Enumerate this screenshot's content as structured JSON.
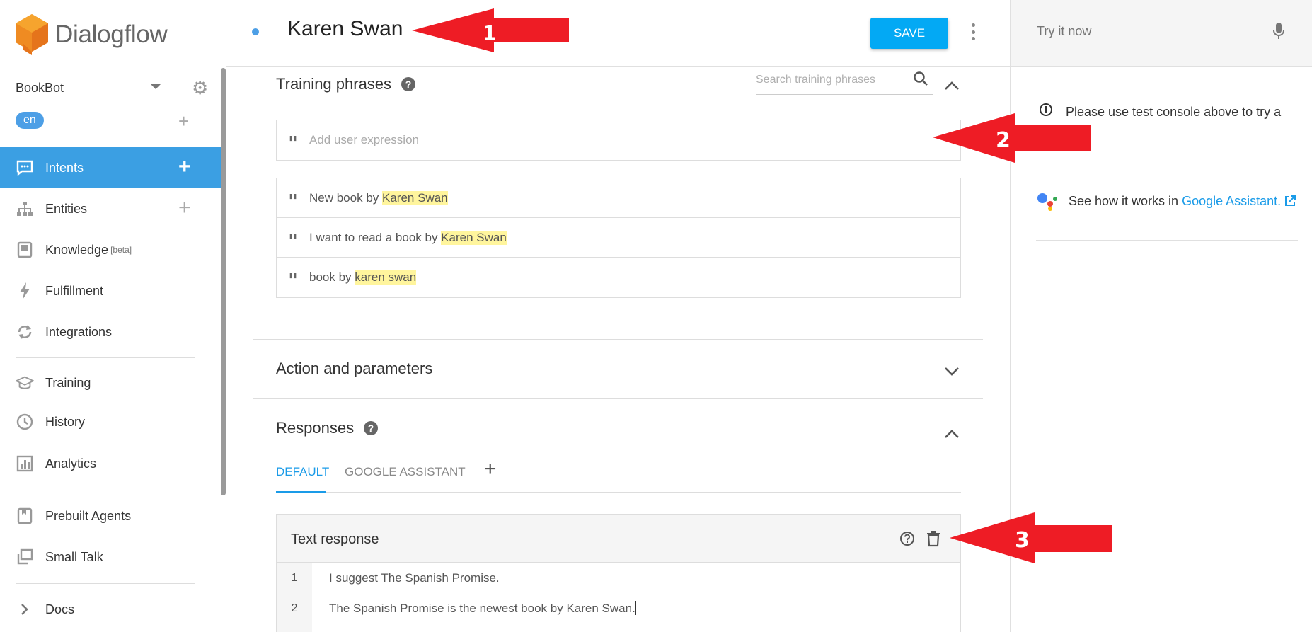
{
  "sidebar": {
    "logo_text": "Dialogflow",
    "agent_name": "BookBot",
    "language": "en",
    "nav": [
      {
        "label": "Intents"
      },
      {
        "label": "Entities"
      },
      {
        "label": "Knowledge",
        "badge": "[beta]"
      },
      {
        "label": "Fulfillment"
      },
      {
        "label": "Integrations"
      },
      {
        "label": "Training"
      },
      {
        "label": "History"
      },
      {
        "label": "Analytics"
      },
      {
        "label": "Prebuilt Agents"
      },
      {
        "label": "Small Talk"
      },
      {
        "label": "Docs"
      }
    ]
  },
  "header": {
    "intent_name": "Karen Swan",
    "save_label": "SAVE"
  },
  "right_panel": {
    "try_placeholder": "Try it now",
    "info_text": "Please use test console above to try a",
    "info_text_cont": ".",
    "ga_text": "See how it works in",
    "ga_link": "Google Assistant."
  },
  "training": {
    "title": "Training phrases",
    "search_placeholder": "Search training phrases",
    "add_placeholder": "Add user expression",
    "phrases": [
      {
        "prefix": "New book by ",
        "entity": "Karen Swan"
      },
      {
        "prefix": "I want to read a book by ",
        "entity": "Karen Swan"
      },
      {
        "prefix": "book by ",
        "entity": "karen swan"
      }
    ]
  },
  "action": {
    "title": "Action and parameters"
  },
  "responses": {
    "title": "Responses",
    "tabs": [
      "DEFAULT",
      "GOOGLE ASSISTANT"
    ],
    "text_response_title": "Text response",
    "lines": [
      {
        "num": "1",
        "text": "I suggest The Spanish Promise."
      },
      {
        "num": "2",
        "text": "The Spanish Promise is the newest book by Karen Swan."
      }
    ]
  },
  "annotations": [
    "1",
    "2",
    "3"
  ],
  "colors": {
    "primary": "#3b9fe3",
    "save": "#03a9f4",
    "highlight": "#fff59d",
    "arrow": "#ee1c25"
  }
}
